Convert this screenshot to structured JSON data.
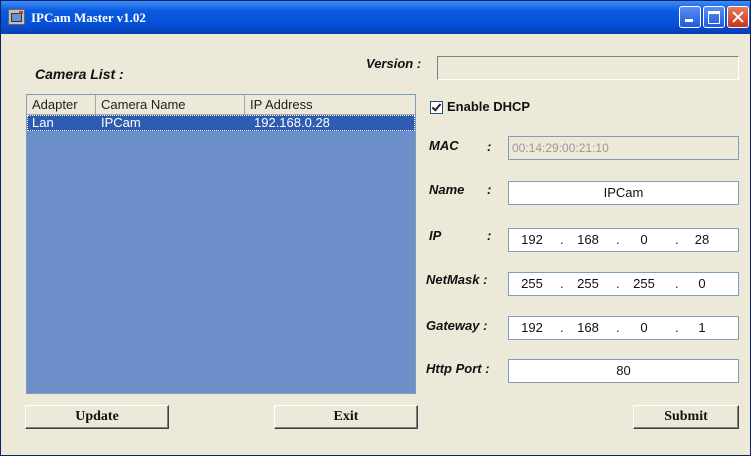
{
  "window": {
    "title": "IPCam Master v1.02"
  },
  "labels": {
    "camera_list": "Camera List :",
    "version": "Version :"
  },
  "version_value": "",
  "camera_list": {
    "columns": [
      "Adapter",
      "Camera Name",
      "IP Address"
    ],
    "rows": [
      {
        "adapter": "Lan",
        "name": "IPCam",
        "ip": "192.168.0.28",
        "selected": true
      }
    ]
  },
  "dhcp": {
    "label": "Enable DHCP",
    "checked": true
  },
  "form": {
    "mac_label": "MAC",
    "mac_value": "00:14:29:00:21:10",
    "name_label": "Name",
    "name_value": "IPCam",
    "ip_label": "IP",
    "ip": [
      "192",
      "168",
      "0",
      "28"
    ],
    "netmask_label": "NetMask :",
    "netmask": [
      "255",
      "255",
      "255",
      "0"
    ],
    "gateway_label": "Gateway :",
    "gateway": [
      "192",
      "168",
      "0",
      "1"
    ],
    "httpport_label": "Http Port :",
    "httpport_value": "80",
    "colon": ":",
    "ip_dot": "."
  },
  "buttons": {
    "update": "Update",
    "exit": "Exit",
    "submit": "Submit"
  },
  "colors": {
    "titlebar": "#0550D8",
    "list_bg": "#6C8FC9",
    "selection": "#2E5CB0",
    "window_bg": "#ECE9D8"
  }
}
